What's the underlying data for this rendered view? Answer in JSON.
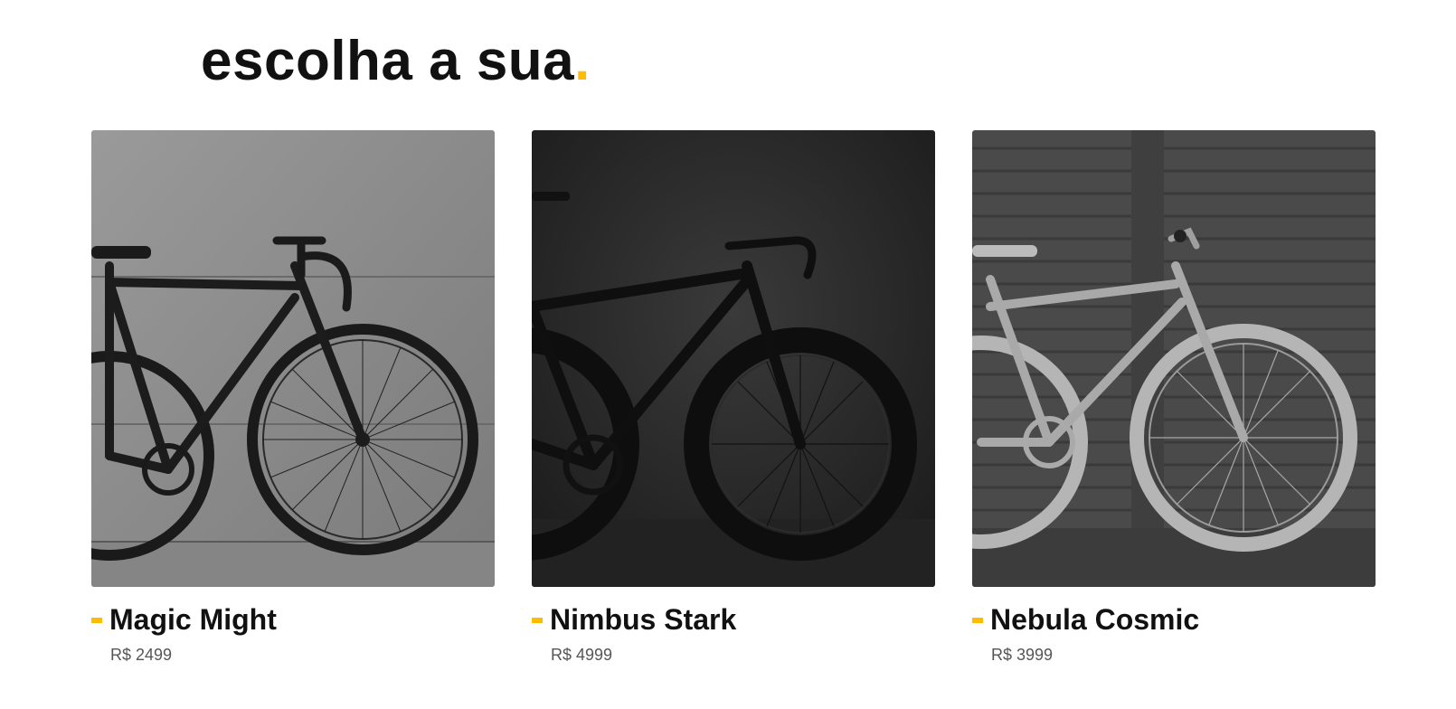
{
  "headline": {
    "text": "escolha a sua",
    "accent": "."
  },
  "colors": {
    "accent": "#ffbb00",
    "text": "#111111",
    "muted": "#555555"
  },
  "products": [
    {
      "name": "Magic Might",
      "price": "R$ 2499",
      "image": "black-fixie-bike-photo"
    },
    {
      "name": "Nimbus Stark",
      "price": "R$ 4999",
      "image": "dark-road-bike-photo"
    },
    {
      "name": "Nebula Cosmic",
      "price": "R$ 3999",
      "image": "light-single-speed-bike-photo"
    }
  ]
}
